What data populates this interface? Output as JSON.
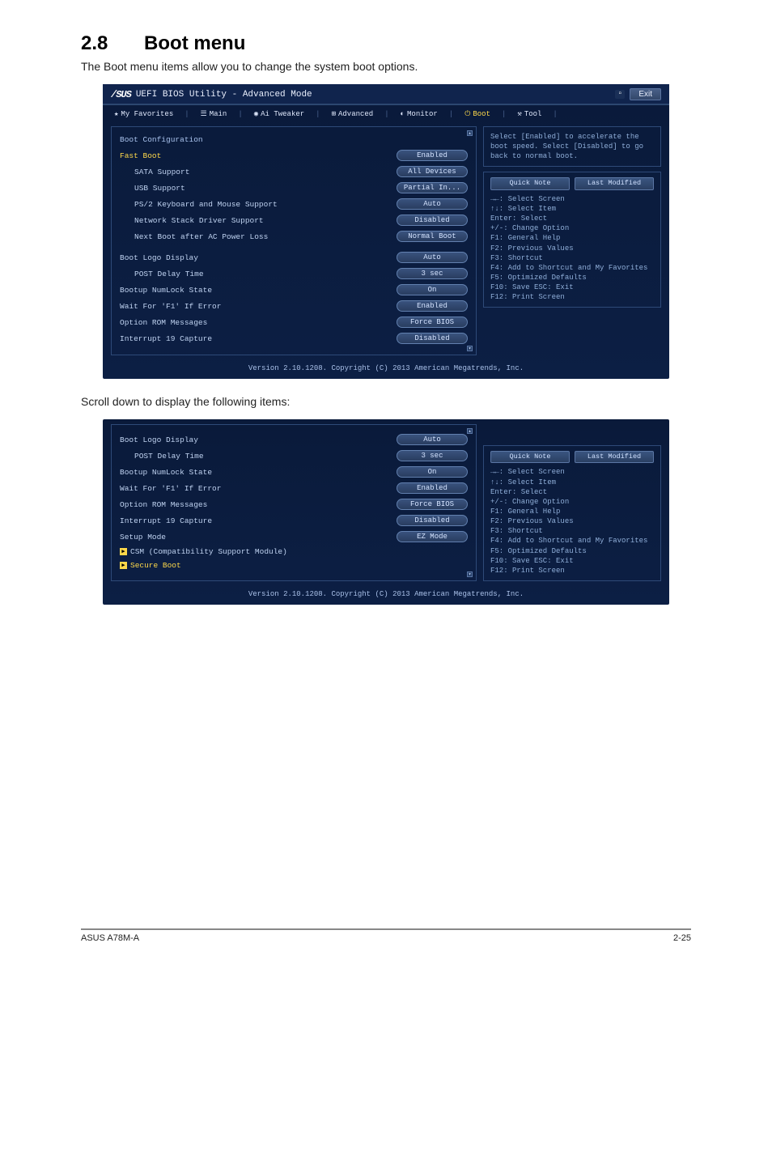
{
  "doc": {
    "heading_num": "2.8",
    "heading_text": "Boot menu",
    "intro": "The Boot menu items allow you to change the system boot options.",
    "scroll_note": "Scroll down to display the following items:",
    "footer_model": "ASUS A78M-A",
    "footer_page": "2-25"
  },
  "bios": {
    "logo": "/SUS",
    "title": "UEFI BIOS Utility - Advanced Mode",
    "exit_label": "Exit",
    "menubar": {
      "my_favorites": "My Favorites",
      "main": "Main",
      "ai_tweaker": "Ai Tweaker",
      "advanced": "Advanced",
      "monitor": "Monitor",
      "boot": "Boot",
      "tool": "Tool"
    },
    "help_text": "Select [Enabled] to accelerate the boot speed. Select [Disabled] to go back to normal boot.",
    "quick_note": "Quick Note",
    "last_modified": "Last Modified",
    "nav_help": [
      "→←: Select Screen",
      "↑↓: Select Item",
      "Enter: Select",
      "+/-: Change Option",
      "F1: General Help",
      "F2: Previous Values",
      "F3: Shortcut",
      "F4: Add to Shortcut and My Favorites",
      "F5: Optimized Defaults",
      "F10: Save  ESC: Exit",
      "F12: Print Screen"
    ],
    "footer": "Version 2.10.1208. Copyright (C) 2013 American Megatrends, Inc.",
    "panel1": {
      "section": "Boot Configuration",
      "rows": [
        {
          "label": "Fast Boot",
          "value": "Enabled",
          "highlight": true
        },
        {
          "label": "SATA Support",
          "value": "All Devices",
          "indent": true
        },
        {
          "label": "USB Support",
          "value": "Partial In...",
          "indent": true
        },
        {
          "label": "PS/2 Keyboard and Mouse Support",
          "value": "Auto",
          "indent": true
        },
        {
          "label": "Network Stack Driver Support",
          "value": "Disabled",
          "indent": true
        },
        {
          "label": "Next Boot after AC Power Loss",
          "value": "Normal Boot",
          "indent": true
        }
      ],
      "rows2": [
        {
          "label": "Boot Logo Display",
          "value": "Auto"
        },
        {
          "label": "POST Delay Time",
          "value": "3 sec",
          "indent": true
        },
        {
          "label": "Bootup NumLock State",
          "value": "On"
        },
        {
          "label": "Wait For 'F1' If Error",
          "value": "Enabled"
        },
        {
          "label": "Option ROM Messages",
          "value": "Force BIOS"
        },
        {
          "label": "Interrupt 19 Capture",
          "value": "Disabled"
        }
      ]
    },
    "panel2": {
      "rows": [
        {
          "label": "Boot Logo Display",
          "value": "Auto"
        },
        {
          "label": "POST Delay Time",
          "value": "3 sec",
          "indent": true
        },
        {
          "label": "Bootup NumLock State",
          "value": "On"
        },
        {
          "label": "Wait For 'F1' If Error",
          "value": "Enabled"
        },
        {
          "label": "Option ROM Messages",
          "value": "Force BIOS"
        },
        {
          "label": "Interrupt 19 Capture",
          "value": "Disabled"
        },
        {
          "label": "Setup Mode",
          "value": "EZ Mode"
        }
      ],
      "links": [
        {
          "label": "CSM (Compatibility Support Module)"
        },
        {
          "label": "Secure Boot",
          "highlight": true
        }
      ]
    }
  }
}
